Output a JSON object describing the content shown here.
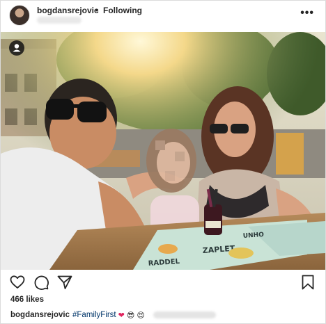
{
  "header": {
    "username": "bogdansrejovic",
    "separator": "•",
    "follow_state": "Following",
    "more_glyph": "•••"
  },
  "photo": {
    "menu_sign_line1": "ZAPLET",
    "menu_sign_line2": "UNHO",
    "menu_sign_line3": "RADDEL",
    "people_tag_icon": "user-icon"
  },
  "actions": {
    "icons": [
      "heart-icon",
      "comment-icon",
      "share-icon",
      "bookmark-icon"
    ]
  },
  "likes": "466 likes",
  "caption": {
    "username": "bogdansrejovic",
    "hashtag": "#FamilyFirst",
    "emojis": [
      "❤",
      "😎",
      "😍"
    ]
  },
  "colors": {
    "text": "#262626",
    "hashtag": "#003569",
    "border": "#dbdbdb",
    "heart_red": "#e0245e"
  }
}
